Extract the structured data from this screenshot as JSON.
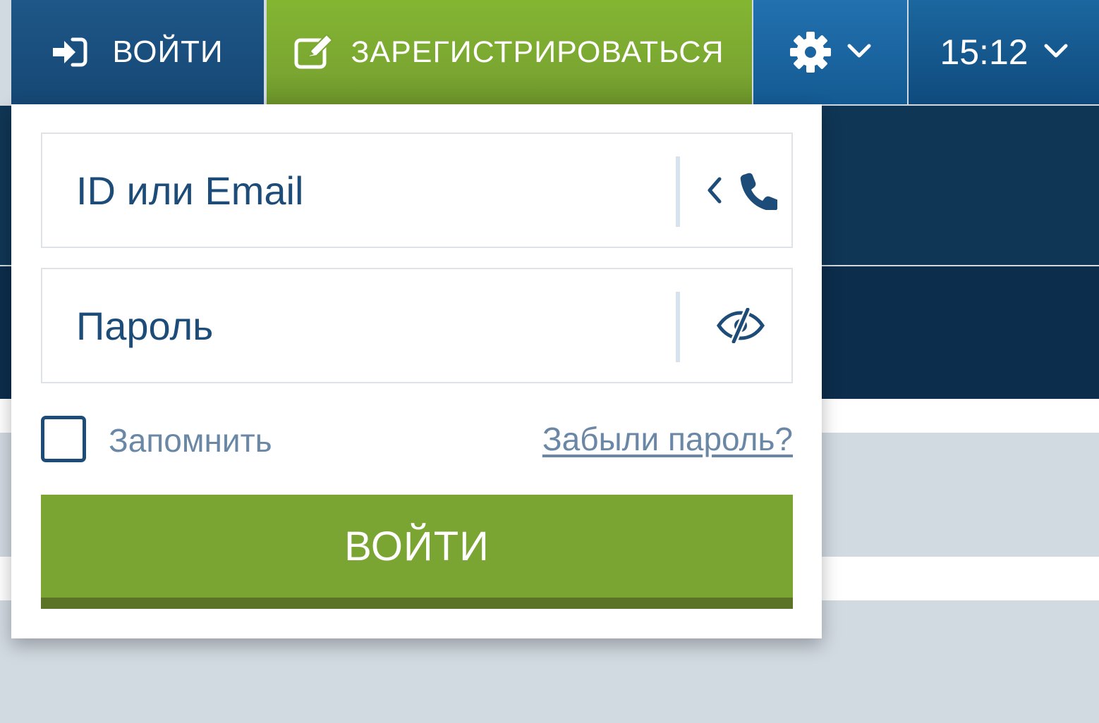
{
  "topbar": {
    "login_label": "ВОЙТИ",
    "register_label": "ЗАРЕГИСТРИРОВАТЬСЯ",
    "time": "15:12",
    "login_icon": "sign-in-icon",
    "register_icon": "edit-icon",
    "settings_icon": "gear-icon",
    "chevron_icon": "chevron-down-icon"
  },
  "login_form": {
    "id_placeholder": "ID или Email",
    "id_value": "",
    "password_placeholder": "Пароль",
    "password_value": "",
    "id_field_icons": [
      "chevron-left-icon",
      "phone-icon"
    ],
    "password_field_icon": "eye-slash-icon",
    "remember_label": "Запомнить",
    "remember_checked": false,
    "forgot_label": "Забыли пароль?",
    "submit_label": "ВОЙТИ"
  },
  "colors": {
    "login_blue": "#1e5788",
    "register_green": "#84b532",
    "settings_blue": "#2271b0",
    "time_blue": "#1b679f",
    "submit_green": "#7aa532",
    "submit_shadow": "#5a7327",
    "field_text": "#1e4c78",
    "muted_text": "#6a88a6"
  }
}
